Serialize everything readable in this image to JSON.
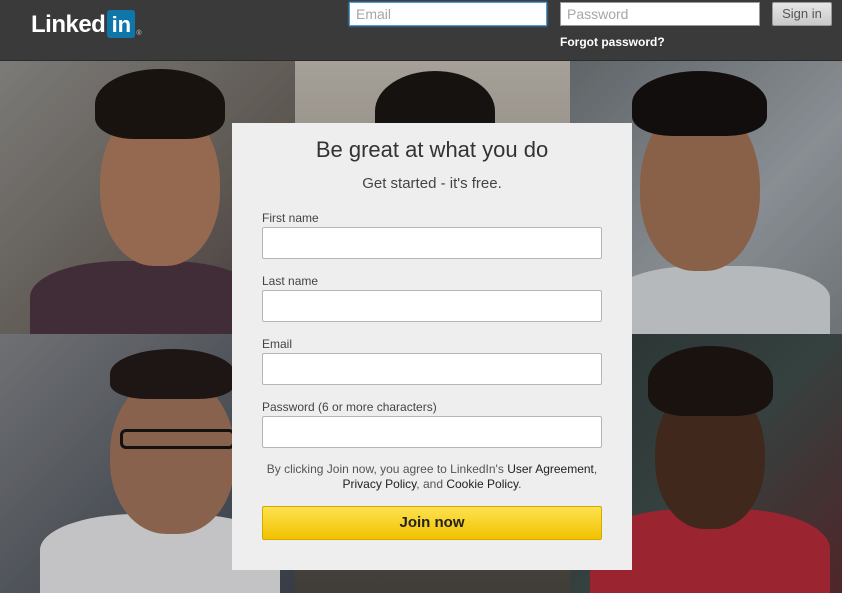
{
  "header": {
    "logo_text": "Linked",
    "logo_box": "in",
    "logo_reg": "®",
    "email_placeholder": "Email",
    "password_placeholder": "Password",
    "signin_label": "Sign in",
    "forgot_label": "Forgot password?"
  },
  "signup": {
    "title": "Be great at what you do",
    "subtitle": "Get started - it's free.",
    "fields": [
      {
        "label": "First name",
        "value": ""
      },
      {
        "label": "Last name",
        "value": ""
      },
      {
        "label": "Email",
        "value": ""
      },
      {
        "label": "Password (6 or more characters)",
        "value": ""
      }
    ],
    "terms_prefix": "By clicking Join now, you agree to LinkedIn's ",
    "user_agreement": "User Agreement",
    "comma": ",",
    "privacy_policy": "Privacy Policy",
    "and_text": ", and ",
    "cookie_policy": "Cookie Policy",
    "period": ".",
    "join_label": "Join now"
  },
  "colors": {
    "brand": "#0e76a8",
    "join_button": "#f5c800",
    "header_bg": "#3a3a3a",
    "card_bg": "#eeeeee"
  }
}
